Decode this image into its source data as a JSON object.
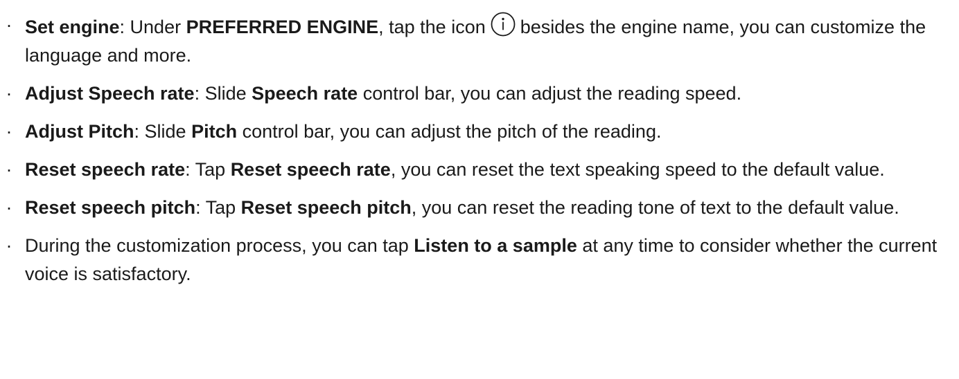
{
  "items": [
    {
      "term": "Set engine",
      "sep": ": Under ",
      "bold2": "PREFERRED ENGINE",
      "text2": ", tap the icon",
      "icon": "info-icon",
      "text3": "besides the engine name, you can customize the language and more."
    },
    {
      "term": "Adjust Speech rate",
      "sep": ": Slide ",
      "bold2": "Speech rate",
      "text2": " control bar, you can adjust the reading speed."
    },
    {
      "term": "Adjust Pitch",
      "sep": ": Slide ",
      "bold2": "Pitch",
      "text2": " control bar, you can adjust the pitch of the reading."
    },
    {
      "term": "Reset speech rate",
      "sep": ": Tap ",
      "bold2": "Reset speech rate",
      "text2": ", you can reset the text speaking speed to the default value."
    },
    {
      "term": "Reset speech pitch",
      "sep": ": Tap ",
      "bold2": "Reset speech pitch",
      "text2": ", you can reset the reading tone of text to the default value."
    },
    {
      "text1": "During the customization process, you can tap ",
      "bold2": "Listen to a sample",
      "text2": " at any time to consider whether the current voice is satisfactory."
    }
  ],
  "bullet_glyph": "·"
}
